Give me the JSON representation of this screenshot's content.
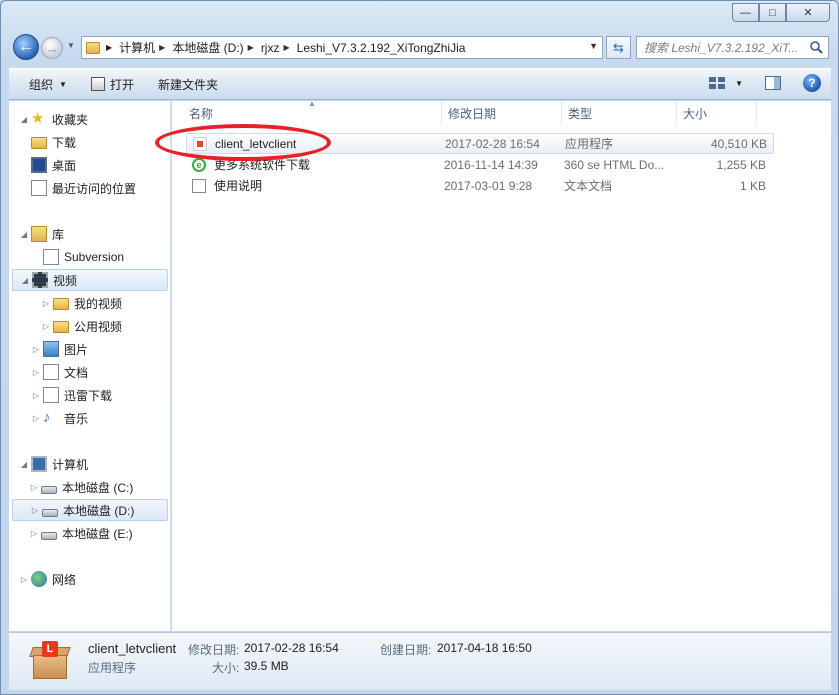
{
  "window": {
    "caption_buttons": {
      "minimize": "—",
      "maximize": "□",
      "close": "✕"
    }
  },
  "address_bar": {
    "crumbs": [
      "计算机",
      "本地磁盘 (D:)",
      "rjxz",
      "Leshi_V7.3.2.192_XiTongZhiJia"
    ],
    "search_placeholder": "搜索 Leshi_V7.3.2.192_XiT..."
  },
  "toolbar": {
    "organize": "组织",
    "open": "打开",
    "new_folder": "新建文件夹"
  },
  "nav": {
    "favorites": "收藏夹",
    "downloads": "下载",
    "desktop": "桌面",
    "recent": "最近访问的位置",
    "libraries": "库",
    "subversion": "Subversion",
    "videos": "视频",
    "my_videos": "我的视频",
    "public_videos": "公用视频",
    "pictures": "图片",
    "documents": "文档",
    "xunlei": "迅雷下载",
    "music": "音乐",
    "computer": "计算机",
    "drive_c": "本地磁盘 (C:)",
    "drive_d": "本地磁盘 (D:)",
    "drive_e": "本地磁盘 (E:)",
    "network": "网络"
  },
  "columns": {
    "name": "名称",
    "modified": "修改日期",
    "type": "类型",
    "size": "大小"
  },
  "files": [
    {
      "name": "client_letvclient",
      "modified": "2017-02-28 16:54",
      "type": "应用程序",
      "size": "40,510 KB"
    },
    {
      "name": "更多系统软件下载",
      "modified": "2016-11-14 14:39",
      "type": "360 se HTML Do...",
      "size": "1,255 KB"
    },
    {
      "name": "使用说明",
      "modified": "2017-03-01 9:28",
      "type": "文本文档",
      "size": "1 KB"
    }
  ],
  "details": {
    "name": "client_letvclient",
    "type": "应用程序",
    "modified_label": "修改日期:",
    "modified_value": "2017-02-28 16:54",
    "created_label": "创建日期:",
    "created_value": "2017-04-18 16:50",
    "size_label": "大小:",
    "size_value": "39.5 MB",
    "logo_letter": "L"
  },
  "colors": {
    "highlight_oval": "#e8202a",
    "accent": "#2a63b4"
  }
}
